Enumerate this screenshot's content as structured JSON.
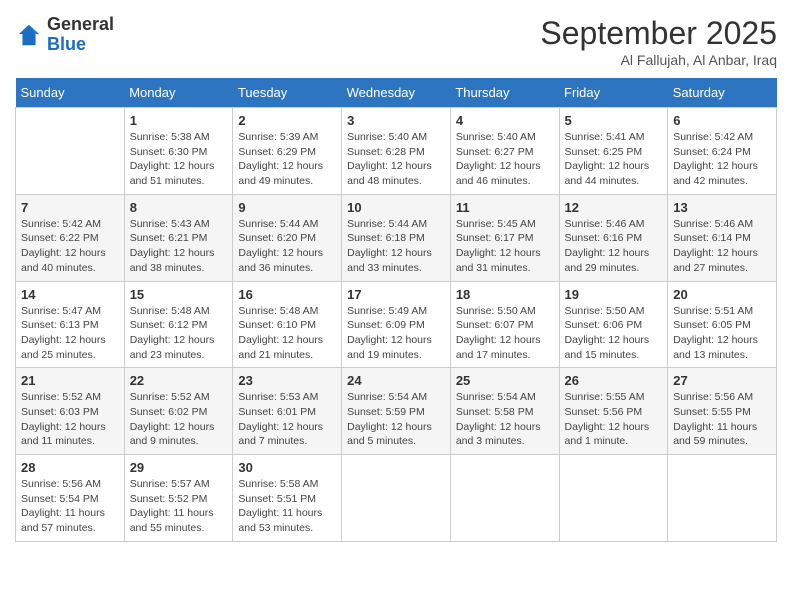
{
  "header": {
    "logo_line1": "General",
    "logo_line2": "Blue",
    "month": "September 2025",
    "location": "Al Fallujah, Al Anbar, Iraq"
  },
  "weekdays": [
    "Sunday",
    "Monday",
    "Tuesday",
    "Wednesday",
    "Thursday",
    "Friday",
    "Saturday"
  ],
  "weeks": [
    [
      {
        "day": "",
        "info": ""
      },
      {
        "day": "1",
        "info": "Sunrise: 5:38 AM\nSunset: 6:30 PM\nDaylight: 12 hours\nand 51 minutes."
      },
      {
        "day": "2",
        "info": "Sunrise: 5:39 AM\nSunset: 6:29 PM\nDaylight: 12 hours\nand 49 minutes."
      },
      {
        "day": "3",
        "info": "Sunrise: 5:40 AM\nSunset: 6:28 PM\nDaylight: 12 hours\nand 48 minutes."
      },
      {
        "day": "4",
        "info": "Sunrise: 5:40 AM\nSunset: 6:27 PM\nDaylight: 12 hours\nand 46 minutes."
      },
      {
        "day": "5",
        "info": "Sunrise: 5:41 AM\nSunset: 6:25 PM\nDaylight: 12 hours\nand 44 minutes."
      },
      {
        "day": "6",
        "info": "Sunrise: 5:42 AM\nSunset: 6:24 PM\nDaylight: 12 hours\nand 42 minutes."
      }
    ],
    [
      {
        "day": "7",
        "info": "Sunrise: 5:42 AM\nSunset: 6:22 PM\nDaylight: 12 hours\nand 40 minutes."
      },
      {
        "day": "8",
        "info": "Sunrise: 5:43 AM\nSunset: 6:21 PM\nDaylight: 12 hours\nand 38 minutes."
      },
      {
        "day": "9",
        "info": "Sunrise: 5:44 AM\nSunset: 6:20 PM\nDaylight: 12 hours\nand 36 minutes."
      },
      {
        "day": "10",
        "info": "Sunrise: 5:44 AM\nSunset: 6:18 PM\nDaylight: 12 hours\nand 33 minutes."
      },
      {
        "day": "11",
        "info": "Sunrise: 5:45 AM\nSunset: 6:17 PM\nDaylight: 12 hours\nand 31 minutes."
      },
      {
        "day": "12",
        "info": "Sunrise: 5:46 AM\nSunset: 6:16 PM\nDaylight: 12 hours\nand 29 minutes."
      },
      {
        "day": "13",
        "info": "Sunrise: 5:46 AM\nSunset: 6:14 PM\nDaylight: 12 hours\nand 27 minutes."
      }
    ],
    [
      {
        "day": "14",
        "info": "Sunrise: 5:47 AM\nSunset: 6:13 PM\nDaylight: 12 hours\nand 25 minutes."
      },
      {
        "day": "15",
        "info": "Sunrise: 5:48 AM\nSunset: 6:12 PM\nDaylight: 12 hours\nand 23 minutes."
      },
      {
        "day": "16",
        "info": "Sunrise: 5:48 AM\nSunset: 6:10 PM\nDaylight: 12 hours\nand 21 minutes."
      },
      {
        "day": "17",
        "info": "Sunrise: 5:49 AM\nSunset: 6:09 PM\nDaylight: 12 hours\nand 19 minutes."
      },
      {
        "day": "18",
        "info": "Sunrise: 5:50 AM\nSunset: 6:07 PM\nDaylight: 12 hours\nand 17 minutes."
      },
      {
        "day": "19",
        "info": "Sunrise: 5:50 AM\nSunset: 6:06 PM\nDaylight: 12 hours\nand 15 minutes."
      },
      {
        "day": "20",
        "info": "Sunrise: 5:51 AM\nSunset: 6:05 PM\nDaylight: 12 hours\nand 13 minutes."
      }
    ],
    [
      {
        "day": "21",
        "info": "Sunrise: 5:52 AM\nSunset: 6:03 PM\nDaylight: 12 hours\nand 11 minutes."
      },
      {
        "day": "22",
        "info": "Sunrise: 5:52 AM\nSunset: 6:02 PM\nDaylight: 12 hours\nand 9 minutes."
      },
      {
        "day": "23",
        "info": "Sunrise: 5:53 AM\nSunset: 6:01 PM\nDaylight: 12 hours\nand 7 minutes."
      },
      {
        "day": "24",
        "info": "Sunrise: 5:54 AM\nSunset: 5:59 PM\nDaylight: 12 hours\nand 5 minutes."
      },
      {
        "day": "25",
        "info": "Sunrise: 5:54 AM\nSunset: 5:58 PM\nDaylight: 12 hours\nand 3 minutes."
      },
      {
        "day": "26",
        "info": "Sunrise: 5:55 AM\nSunset: 5:56 PM\nDaylight: 12 hours\nand 1 minute."
      },
      {
        "day": "27",
        "info": "Sunrise: 5:56 AM\nSunset: 5:55 PM\nDaylight: 11 hours\nand 59 minutes."
      }
    ],
    [
      {
        "day": "28",
        "info": "Sunrise: 5:56 AM\nSunset: 5:54 PM\nDaylight: 11 hours\nand 57 minutes."
      },
      {
        "day": "29",
        "info": "Sunrise: 5:57 AM\nSunset: 5:52 PM\nDaylight: 11 hours\nand 55 minutes."
      },
      {
        "day": "30",
        "info": "Sunrise: 5:58 AM\nSunset: 5:51 PM\nDaylight: 11 hours\nand 53 minutes."
      },
      {
        "day": "",
        "info": ""
      },
      {
        "day": "",
        "info": ""
      },
      {
        "day": "",
        "info": ""
      },
      {
        "day": "",
        "info": ""
      }
    ]
  ]
}
